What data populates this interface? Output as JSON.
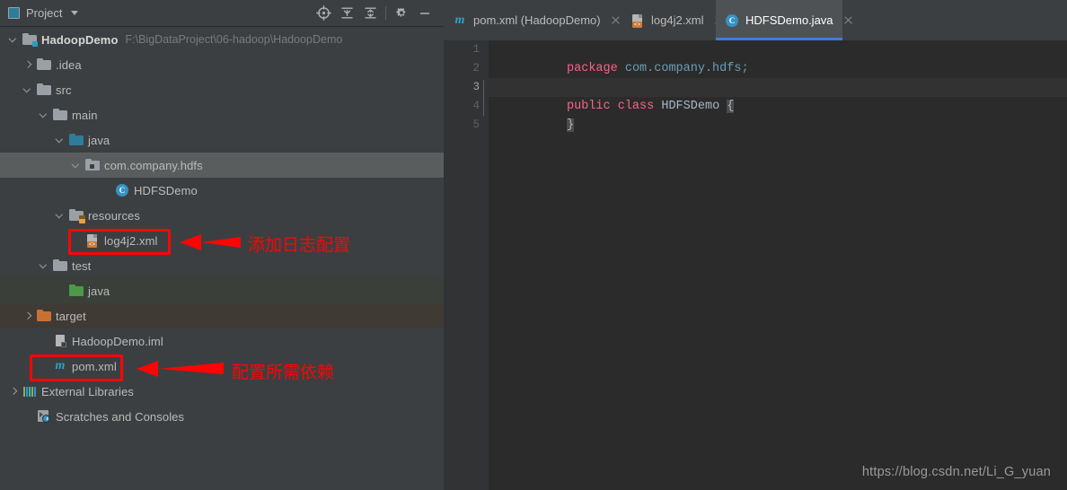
{
  "panel": {
    "title": "Project",
    "title_icon": "project-window-icon",
    "dropdown_icon": "chevron-down-icon",
    "toolbar_buttons": [
      {
        "name": "locate-in-tree-icon",
        "label": "Select Opened File"
      },
      {
        "name": "expand-all-icon",
        "label": "Expand All"
      },
      {
        "name": "collapse-all-icon",
        "label": "Collapse All"
      },
      {
        "name": "gear-icon",
        "label": "Settings"
      },
      {
        "name": "minimize-icon",
        "label": "Hide"
      }
    ]
  },
  "tree": [
    {
      "label": "HadoopDemo",
      "path": "F:\\BigDataProject\\06-hadoop\\HadoopDemo",
      "indent": 0,
      "arrow": "expanded",
      "icon": "project-folder-icon",
      "bold": true,
      "state": "normal"
    },
    {
      "label": ".idea",
      "path": "",
      "indent": 1,
      "arrow": "collapsed",
      "icon": "folder-icon",
      "bold": false,
      "state": "normal"
    },
    {
      "label": "src",
      "path": "",
      "indent": 1,
      "arrow": "expanded",
      "icon": "folder-icon",
      "bold": false,
      "state": "normal"
    },
    {
      "label": "main",
      "path": "",
      "indent": 2,
      "arrow": "expanded",
      "icon": "folder-icon",
      "bold": false,
      "state": "normal"
    },
    {
      "label": "java",
      "path": "",
      "indent": 3,
      "arrow": "expanded",
      "icon": "source-root-folder-icon",
      "bold": false,
      "state": "normal"
    },
    {
      "label": "com.company.hdfs",
      "path": "",
      "indent": 4,
      "arrow": "expanded",
      "icon": "package-icon",
      "bold": false,
      "state": "selected"
    },
    {
      "label": "HDFSDemo",
      "path": "",
      "indent": 5,
      "arrow": "none",
      "icon": "java-class-icon",
      "bold": false,
      "state": "normal"
    },
    {
      "label": "resources",
      "path": "",
      "indent": 3,
      "arrow": "expanded",
      "icon": "resources-root-folder-icon",
      "bold": false,
      "state": "normal"
    },
    {
      "label": "log4j2.xml",
      "path": "",
      "indent": 4,
      "arrow": "none",
      "icon": "xml-file-icon",
      "bold": false,
      "state": "normal"
    },
    {
      "label": "test",
      "path": "",
      "indent": 2,
      "arrow": "expanded",
      "icon": "folder-icon",
      "bold": false,
      "state": "normal"
    },
    {
      "label": "java",
      "path": "",
      "indent": 3,
      "arrow": "none",
      "icon": "test-source-root-folder-icon",
      "bold": false,
      "state": "testroot"
    },
    {
      "label": "target",
      "path": "",
      "indent": 1,
      "arrow": "collapsed",
      "icon": "excluded-folder-icon",
      "bold": false,
      "state": "excluded"
    },
    {
      "label": "HadoopDemo.iml",
      "path": "",
      "indent": 2,
      "arrow": "none",
      "icon": "module-iml-icon",
      "bold": false,
      "state": "normal"
    },
    {
      "label": "pom.xml",
      "path": "",
      "indent": 2,
      "arrow": "none",
      "icon": "maven-pom-icon",
      "bold": false,
      "state": "normal"
    },
    {
      "label": "External Libraries",
      "path": "",
      "indent": 0,
      "arrow": "collapsed",
      "icon": "external-libraries-icon",
      "bold": false,
      "state": "normal"
    },
    {
      "label": "Scratches and Consoles",
      "path": "",
      "indent": 0,
      "arrow": "none",
      "icon": "scratches-icon",
      "bold": false,
      "state": "normal"
    }
  ],
  "editor": {
    "tabs": [
      {
        "label": "pom.xml (HadoopDemo)",
        "icon": "maven-pom-icon",
        "active": false
      },
      {
        "label": "log4j2.xml",
        "icon": "xml-file-icon",
        "active": false
      },
      {
        "label": "HDFSDemo.java",
        "icon": "java-class-icon",
        "active": true
      }
    ],
    "gutter_numbers": [
      "1",
      "2",
      "3",
      "4",
      "5"
    ],
    "caret_line": 3,
    "code": [
      {
        "n": 1,
        "tokens": [
          {
            "t": "package",
            "c": "keyword"
          },
          {
            "t": " ",
            "c": "plain"
          },
          {
            "t": "com.company.hdfs;",
            "c": "package"
          }
        ]
      },
      {
        "n": 2,
        "tokens": []
      },
      {
        "n": 3,
        "tokens": [
          {
            "t": "public",
            "c": "keyword"
          },
          {
            "t": " ",
            "c": "plain"
          },
          {
            "t": "class",
            "c": "keyword"
          },
          {
            "t": " ",
            "c": "plain"
          },
          {
            "t": "HDFSDemo",
            "c": "ident"
          },
          {
            "t": " ",
            "c": "plain"
          },
          {
            "t": "{",
            "c": "brace"
          }
        ]
      },
      {
        "n": 4,
        "tokens": [
          {
            "t": "}",
            "c": "brace"
          }
        ]
      },
      {
        "n": 5,
        "tokens": []
      }
    ]
  },
  "watermark": "https://blog.csdn.net/Li_G_yuan",
  "annotations": [
    {
      "name": "log4j2-callout",
      "text": "添加日志配置"
    },
    {
      "name": "pom-callout",
      "text": "配置所需依赖"
    }
  ],
  "colors": {
    "accent_red": "#fb0505",
    "panel_bg": "#3c3f41",
    "editor_bg": "#2b2b2b",
    "tab_active_underline": "#3c7ede",
    "selection": "#5a5d5e"
  }
}
